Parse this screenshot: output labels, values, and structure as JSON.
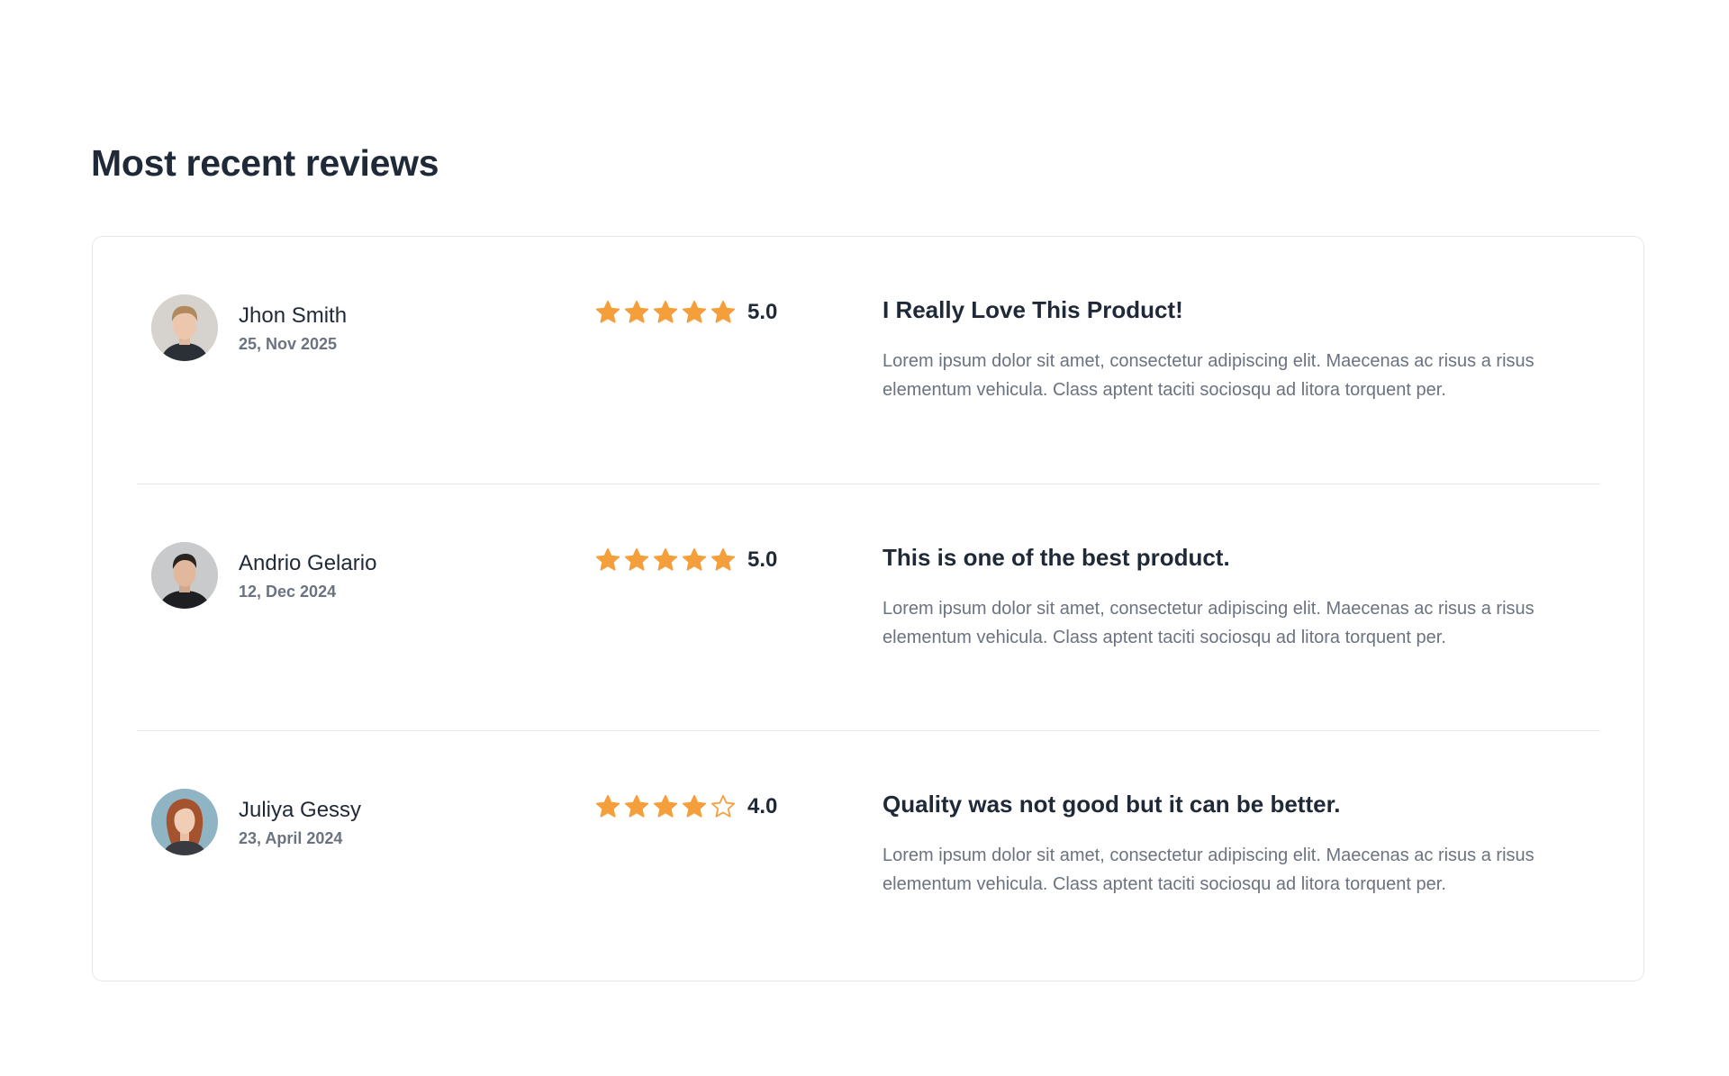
{
  "section": {
    "title": "Most recent reviews"
  },
  "colors": {
    "star_filled": "#f59f3c",
    "star_empty_stroke": "#f59f3c",
    "text_primary": "#1f2937",
    "text_muted": "#6b7280",
    "border": "#e5e7eb"
  },
  "reviews": [
    {
      "name": "Jhon Smith",
      "date": "25, Nov 2025",
      "stars": 5,
      "rating": "5.0",
      "title": "I Really Love This Product!",
      "body": "Lorem ipsum dolor sit amet, consectetur adipiscing elit. Maecenas ac risus a risus elementum vehicula. Class aptent taciti sociosqu ad litora torquent per.",
      "avatar_icon": "avatar-man-light-hair"
    },
    {
      "name": "Andrio Gelario",
      "date": "12, Dec 2024",
      "stars": 5,
      "rating": "5.0",
      "title": "This is one of the best product.",
      "body": "Lorem ipsum dolor sit amet, consectetur adipiscing elit. Maecenas ac risus a risus elementum vehicula. Class aptent taciti sociosqu ad litora torquent per.",
      "avatar_icon": "avatar-man-dark-hair"
    },
    {
      "name": "Juliya Gessy",
      "date": "23, April 2024",
      "stars": 4,
      "rating": "4.0",
      "title": "Quality was not good but it can be better.",
      "body": "Lorem ipsum dolor sit amet, consectetur adipiscing elit. Maecenas ac risus a risus elementum vehicula. Class aptent taciti sociosqu ad litora torquent per.",
      "avatar_icon": "avatar-woman-red-hair"
    }
  ]
}
